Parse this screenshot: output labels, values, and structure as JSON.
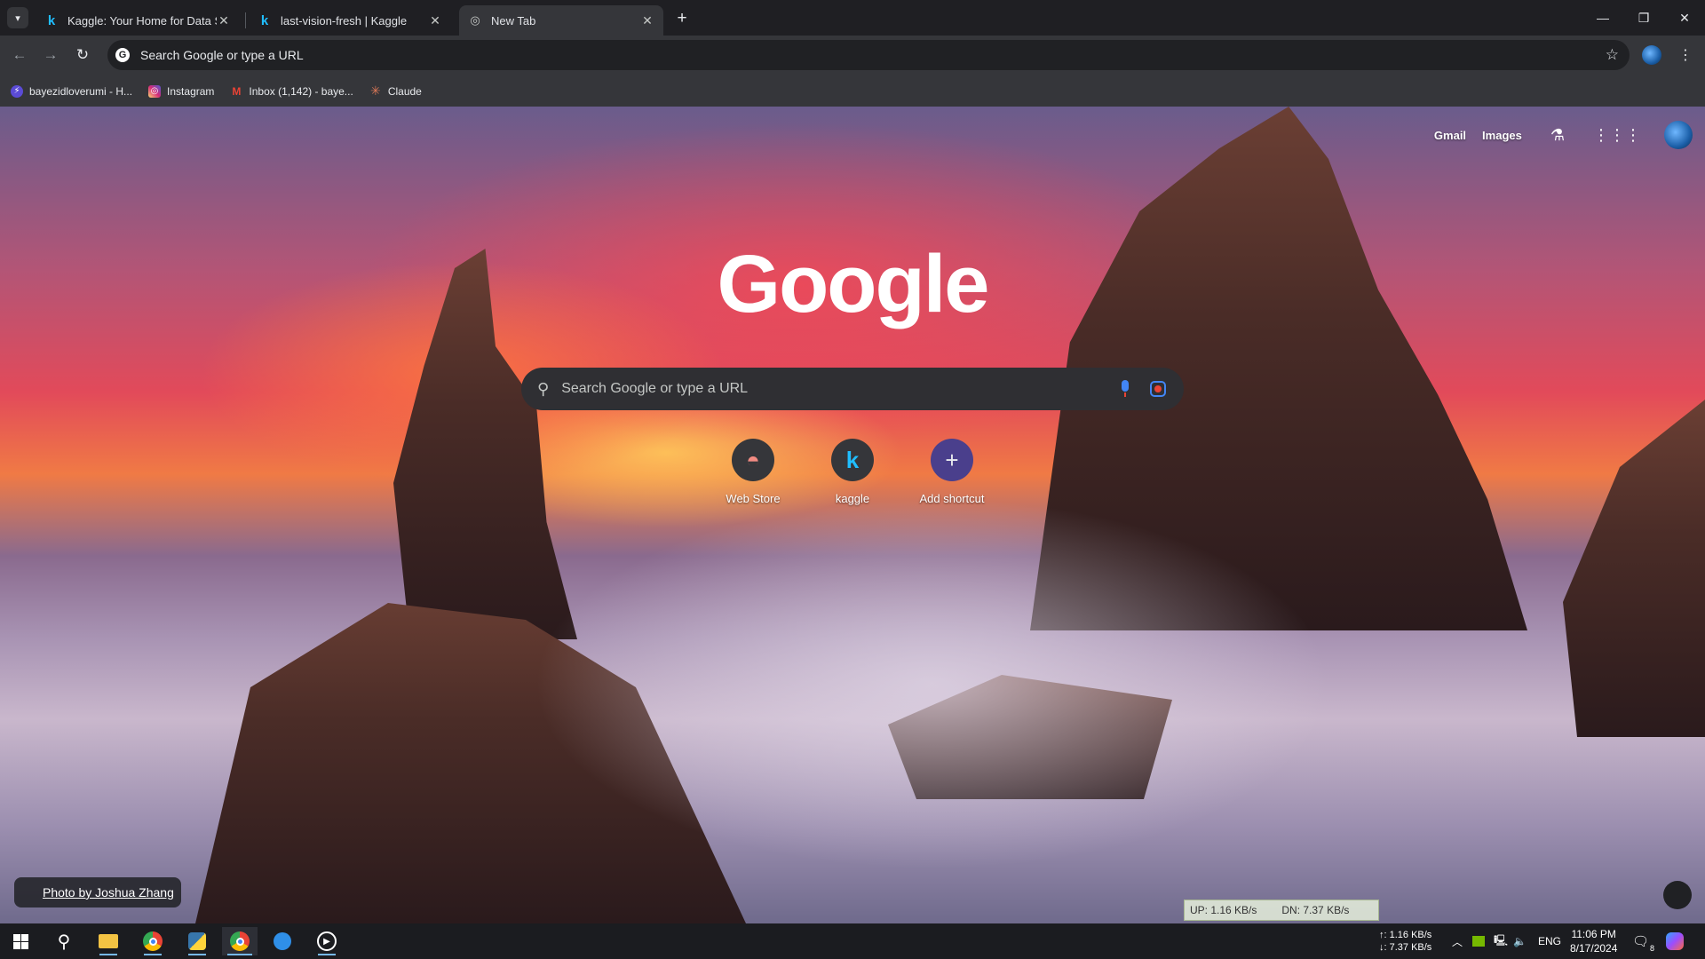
{
  "tabs": [
    {
      "title": "Kaggle: Your Home for Data Sci",
      "icon": "kaggle-icon",
      "glyph": "k"
    },
    {
      "title": "last-vision-fresh | Kaggle",
      "icon": "kaggle-icon",
      "glyph": "k"
    },
    {
      "title": "New Tab",
      "icon": "chrome-icon",
      "glyph": "◎"
    }
  ],
  "omnibox": {
    "text": "Search Google or type a URL"
  },
  "bookmarks": [
    {
      "label": "bayezidloverumi - H...",
      "color": "#5b4bd6"
    },
    {
      "label": "Instagram",
      "color": "#d6249f"
    },
    {
      "label": "Inbox (1,142) - baye...",
      "color": "#ea4335"
    },
    {
      "label": "Claude",
      "color": "#d97757"
    }
  ],
  "ntp": {
    "logo": "Google",
    "search_placeholder": "Search Google or type a URL",
    "top_links": {
      "gmail": "Gmail",
      "images": "Images"
    },
    "shortcuts": [
      {
        "label": "Web Store",
        "glyph": "◓"
      },
      {
        "label": "kaggle",
        "glyph": "k"
      },
      {
        "label": "Add shortcut",
        "glyph": "+"
      }
    ],
    "photo_credit": "Photo by Joshua Zhang"
  },
  "netmeter": {
    "up": "UP: 1.16 KB/s",
    "down": "DN: 7.37 KB/s"
  },
  "taskbar": {
    "net_up": "↑: 1.16 KB/s",
    "net_down": "↓: 7.37 KB/s",
    "lang": "ENG",
    "time": "11:06 PM",
    "date": "8/17/2024",
    "notifications": "8"
  },
  "colors": {
    "accent": "#8ab4f8",
    "brand_blue": "#4285f4"
  }
}
